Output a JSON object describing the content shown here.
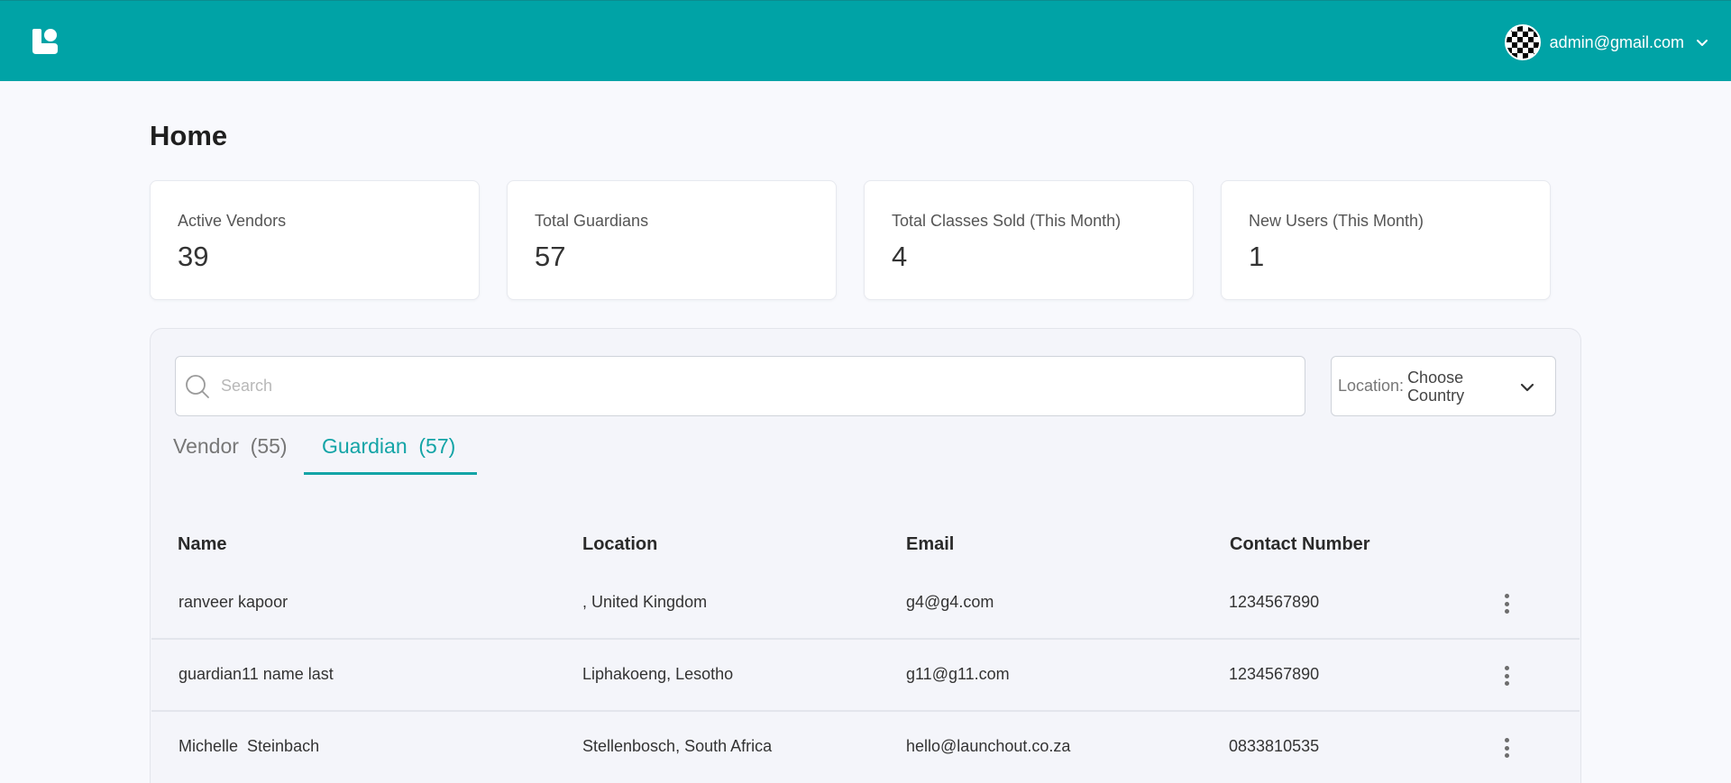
{
  "header": {
    "user_email": "admin@gmail.com"
  },
  "page": {
    "title": "Home"
  },
  "stats": [
    {
      "label": "Active Vendors",
      "value": "39"
    },
    {
      "label": "Total Guardians",
      "value": "57"
    },
    {
      "label": "Total Classes Sold (This Month)",
      "value": "4"
    },
    {
      "label": "New Users (This Month)",
      "value": "1"
    }
  ],
  "search": {
    "placeholder": "Search",
    "value": ""
  },
  "location_filter": {
    "label": "Location:",
    "value": "Choose Country"
  },
  "tabs": [
    {
      "label": "Vendor  (55)",
      "active": false
    },
    {
      "label": "Guardian  (57)",
      "active": true
    }
  ],
  "table": {
    "columns": [
      "Name",
      "Location",
      "Email",
      "Contact Number"
    ],
    "rows": [
      {
        "name": "ranveer kapoor",
        "location": ", United Kingdom",
        "email": "g4@g4.com",
        "contact": "1234567890"
      },
      {
        "name": "guardian11 name last",
        "location": "Liphakoeng, Lesotho",
        "email": "g11@g11.com",
        "contact": "1234567890"
      },
      {
        "name": "Michelle  Steinbach",
        "location": "Stellenbosch, South Africa",
        "email": "hello@launchout.co.za",
        "contact": "0833810535"
      }
    ]
  },
  "colors": {
    "header_bg": "#00a3a6",
    "accent": "#13a4a6",
    "page_bg": "#f8f9fd"
  },
  "icons": [
    "logo-icon",
    "avatar",
    "chevron-down-icon",
    "search-icon",
    "kebab-menu-icon"
  ]
}
